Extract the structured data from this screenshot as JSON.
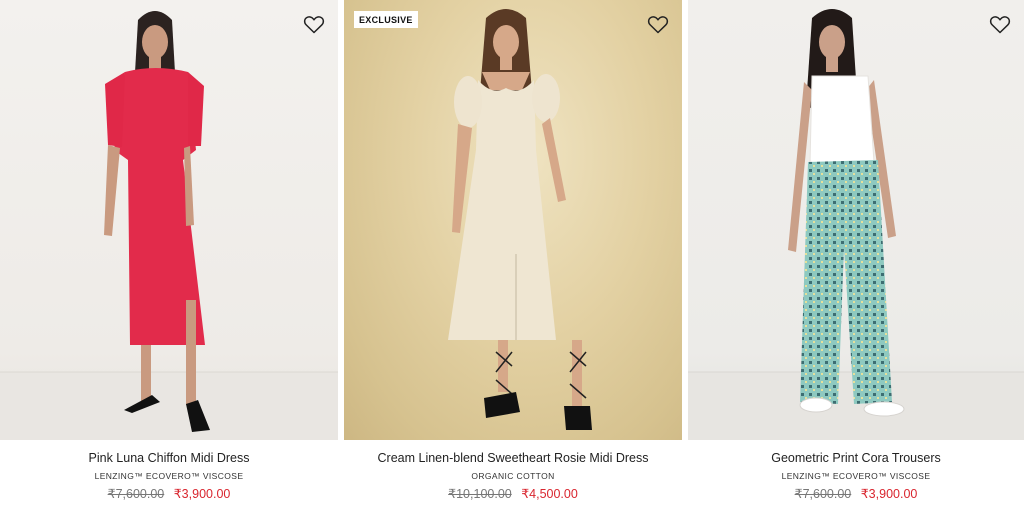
{
  "products": [
    {
      "name": "Pink Luna Chiffon Midi Dress",
      "fabric": "LENZING™ ECOVERO™ VISCOSE",
      "price_old": "₹7,600.00",
      "price_new": "₹3,900.00",
      "badge": "",
      "wishlist_icon": "heart-outline-icon"
    },
    {
      "name": "Cream Linen-blend Sweetheart Rosie Midi Dress",
      "fabric": "ORGANIC COTTON",
      "price_old": "₹10,100.00",
      "price_new": "₹4,500.00",
      "badge": "EXCLUSIVE",
      "wishlist_icon": "heart-outline-icon"
    },
    {
      "name": "Geometric Print Cora Trousers",
      "fabric": "LENZING™ ECOVERO™ VISCOSE",
      "price_old": "₹7,600.00",
      "price_new": "₹3,900.00",
      "badge": "",
      "wishlist_icon": "heart-outline-icon"
    }
  ],
  "colors": {
    "sale_price": "#d9262f",
    "original_price": "#777777",
    "text": "#222222"
  }
}
